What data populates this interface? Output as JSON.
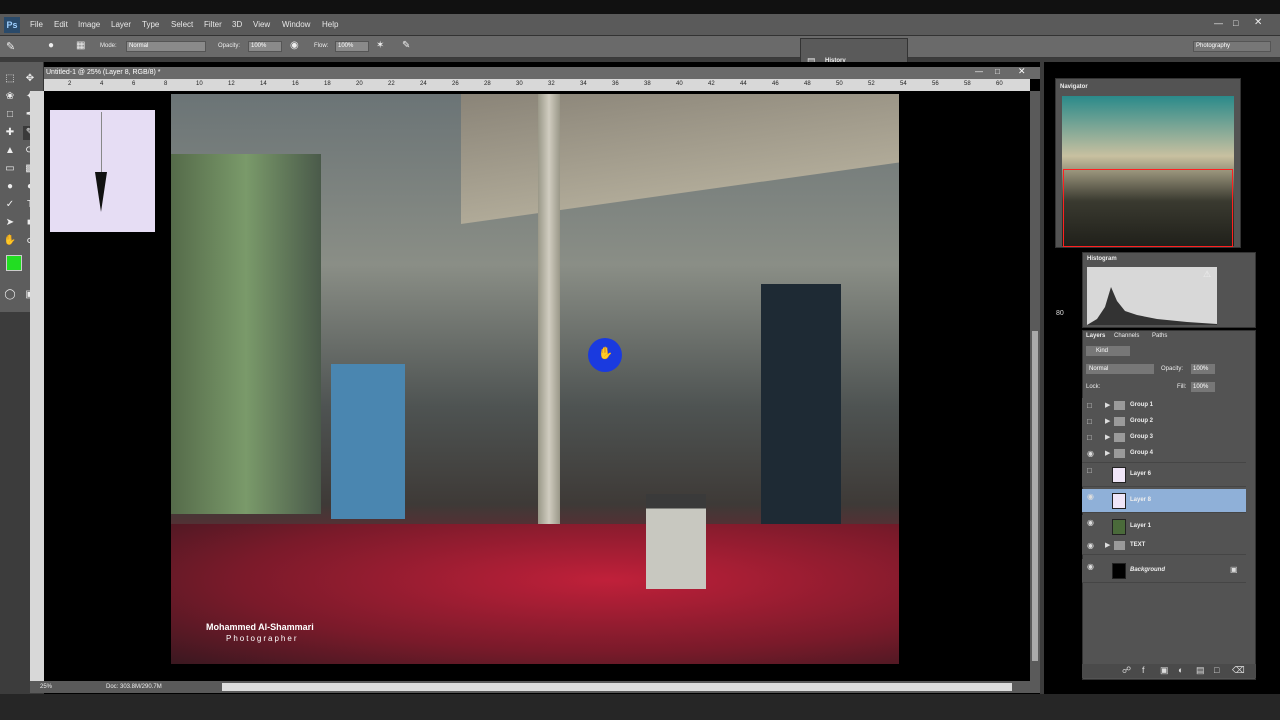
{
  "app": {
    "logo": "Ps"
  },
  "menu": [
    "File",
    "Edit",
    "Image",
    "Layer",
    "Type",
    "Select",
    "Filter",
    "3D",
    "View",
    "Window",
    "Help"
  ],
  "options": {
    "mode_label": "Mode:",
    "mode_value": "Normal",
    "opacity_label": "Opacity:",
    "opacity_value": "100%",
    "flow_label": "Flow:",
    "flow_value": "100%",
    "workspace": "Photography"
  },
  "history": {
    "title": "History"
  },
  "document": {
    "tab": "Untitled-1 @ 25% (Layer 8, RGB/8) *",
    "zoom": "25%",
    "doc_info": "Doc: 303.8M/290.7M"
  },
  "ruler_ticks": [
    "2",
    "4",
    "6",
    "8",
    "10",
    "12",
    "14",
    "16",
    "18",
    "20",
    "22",
    "24",
    "26",
    "28",
    "30",
    "32",
    "34",
    "36",
    "38",
    "40",
    "42",
    "44",
    "46",
    "48",
    "50",
    "52",
    "54",
    "56",
    "58",
    "60"
  ],
  "photo_credit": {
    "name": "Mohammed Al-Shammari",
    "role": "Photographer"
  },
  "navigator": {
    "title": "Navigator",
    "zoom": "80"
  },
  "histogram": {
    "title": "Histogram"
  },
  "layers_panel": {
    "tabs": [
      "Layers",
      "Channels",
      "Paths"
    ],
    "kind": "Kind",
    "blend": "Normal",
    "opacity_label": "Opacity:",
    "opacity_value": "100%",
    "lock_label": "Lock:",
    "fill_label": "Fill:",
    "fill_value": "100%",
    "layers": [
      {
        "name": "Group 1",
        "type": "group",
        "visible": false
      },
      {
        "name": "Group 2",
        "type": "group",
        "visible": false
      },
      {
        "name": "Group 3",
        "type": "group",
        "visible": false
      },
      {
        "name": "Group 4",
        "type": "group",
        "visible": true
      },
      {
        "name": "Layer 6",
        "type": "layer",
        "visible": false
      },
      {
        "name": "Layer 8",
        "type": "layer",
        "visible": true,
        "selected": true
      },
      {
        "name": "Layer 1",
        "type": "layer",
        "visible": true
      },
      {
        "name": "TEXT",
        "type": "group",
        "visible": true
      },
      {
        "name": "Background",
        "type": "background",
        "visible": true
      }
    ]
  },
  "colors": {
    "foreground": "#22dd22",
    "background": "#000000",
    "selection": "#8fb0d8",
    "accent_nav": "#ff2020"
  }
}
